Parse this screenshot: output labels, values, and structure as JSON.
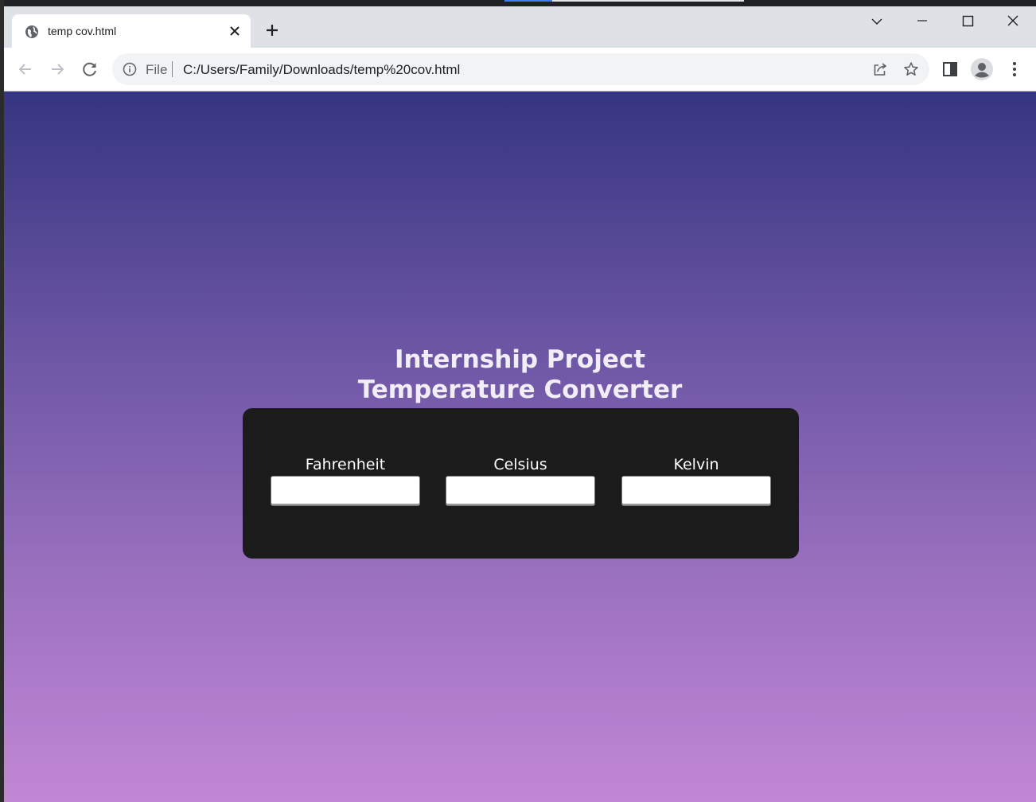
{
  "browser": {
    "tab_title": "temp cov.html",
    "url_scheme": "File",
    "url": "C:/Users/Family/Downloads/temp%20cov.html"
  },
  "page": {
    "heading_line1": "Internship Project",
    "heading_line2": "Temperature Converter",
    "fields": [
      {
        "label": "Fahrenheit",
        "value": ""
      },
      {
        "label": "Celsius",
        "value": ""
      },
      {
        "label": "Kelvin",
        "value": ""
      }
    ]
  },
  "colors": {
    "gradient_top": "#363581",
    "gradient_bottom": "#c287d6",
    "card": "#1b1b1b",
    "heading": "#f1eef8"
  },
  "icons": [
    "globe-icon",
    "close-icon",
    "plus-icon",
    "chevron-down-icon",
    "minimize-icon",
    "maximize-icon",
    "window-close-icon",
    "back-icon",
    "forward-icon",
    "reload-icon",
    "info-icon",
    "share-icon",
    "star-icon",
    "side-panel-icon",
    "profile-icon",
    "more-icon"
  ]
}
